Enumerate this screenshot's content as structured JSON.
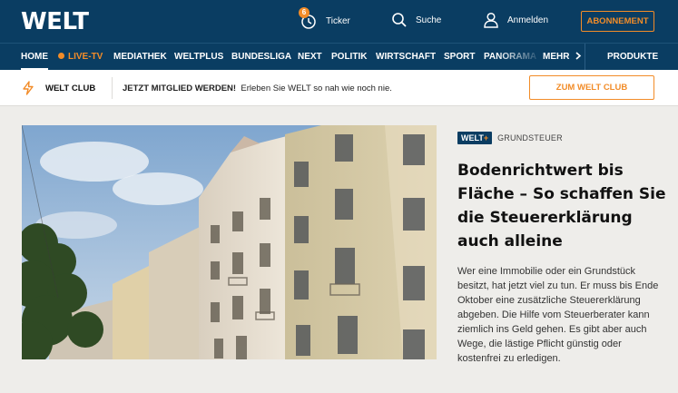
{
  "header": {
    "logo": "WELT",
    "ticker_label": "Ticker",
    "ticker_count": "6",
    "search_label": "Suche",
    "login_label": "Anmelden",
    "subscribe_label": "ABONNEMENT"
  },
  "nav": {
    "items": [
      "HOME",
      "LIVE-TV",
      "MEDIATHEK",
      "WELTPLUS",
      "BUNDESLIGA",
      "NEXT",
      "POLITIK",
      "WIRTSCHAFT",
      "SPORT",
      "PANORAMA",
      "MEHR"
    ],
    "products_label": "PRODUKTE",
    "active": "HOME"
  },
  "club": {
    "name": "WELT CLUB",
    "cta_bold": "JETZT MITGLIED WERDEN!",
    "cta_text": "Erleben Sie WELT so nah wie noch nie.",
    "button_label": "ZUM WELT CLUB"
  },
  "article": {
    "badge": "WELT",
    "badge_plus": "+",
    "kicker": "GRUNDSTEUER",
    "headline": "Bodenrichtwert bis Fläche – So schaffen Sie die Steuererklärung auch alleine",
    "teaser": "Wer eine Immobilie oder ein Grundstück besitzt, hat jetzt viel zu tun. Er muss bis Ende Oktober eine zusätzliche Steuererklärung abgeben. Die Hilfe vom Steuerberater kann ziemlich ins Geld gehen. Es gibt aber auch Wege, die lästige Pflicht günstig oder kostenfrei zu erledigen."
  },
  "colors": {
    "brand_blue": "#0a3d62",
    "accent_orange": "#f28c28"
  }
}
